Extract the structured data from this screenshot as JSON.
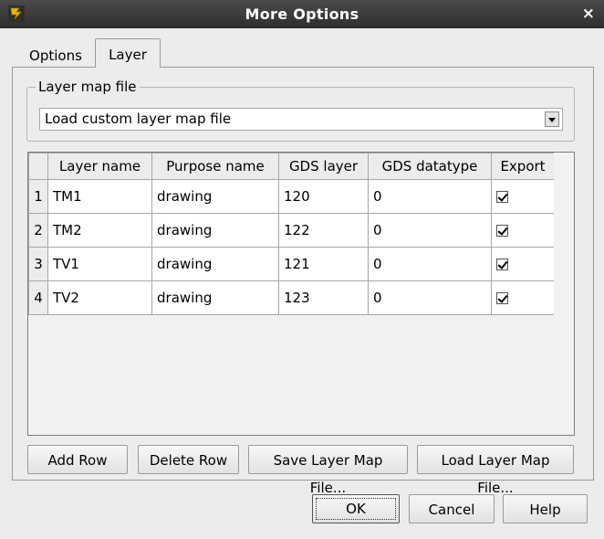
{
  "window": {
    "title": "More Options",
    "app_icon": "app-logo-icon",
    "close_glyph": "×"
  },
  "tabs": [
    {
      "label": "Options",
      "selected": false
    },
    {
      "label": "Layer",
      "selected": true
    }
  ],
  "layer_map": {
    "group_title": "Layer map file",
    "selected_value": "Load custom layer map file"
  },
  "table": {
    "columns": [
      "Layer name",
      "Purpose name",
      "GDS layer",
      "GDS datatype",
      "Export"
    ],
    "rows": [
      {
        "num": "1",
        "layer": "TM1",
        "purpose": "drawing",
        "gds_layer": "120",
        "datatype": "0",
        "export": true
      },
      {
        "num": "2",
        "layer": "TM2",
        "purpose": "drawing",
        "gds_layer": "122",
        "datatype": "0",
        "export": true
      },
      {
        "num": "3",
        "layer": "TV1",
        "purpose": "drawing",
        "gds_layer": "121",
        "datatype": "0",
        "export": true
      },
      {
        "num": "4",
        "layer": "TV2",
        "purpose": "drawing",
        "gds_layer": "123",
        "datatype": "0",
        "export": true
      }
    ]
  },
  "buttons": {
    "add_row": "Add Row",
    "delete_row": "Delete Row",
    "save_map": "Save Layer Map File...",
    "load_map": "Load Layer Map File...",
    "ok": "OK",
    "cancel": "Cancel",
    "help": "Help"
  }
}
